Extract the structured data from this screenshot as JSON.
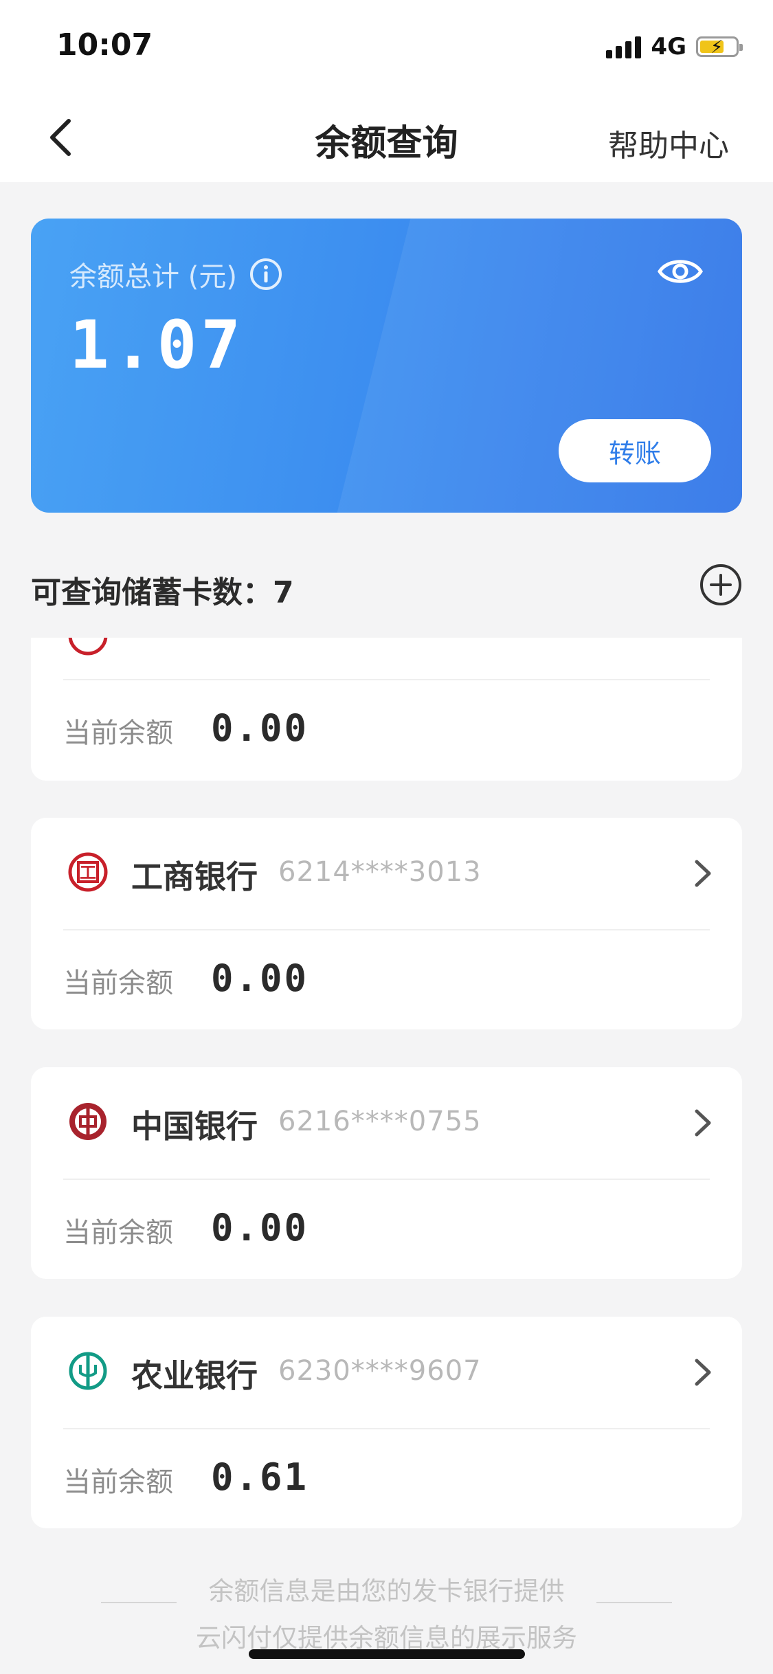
{
  "status_bar": {
    "time": "10:07",
    "network": "4G"
  },
  "nav": {
    "title": "余额查询",
    "help": "帮助中心"
  },
  "summary": {
    "label": "余额总计 (元)",
    "amount": "1.07",
    "transfer_button": "转账"
  },
  "cards_count_label": "可查询储蓄卡数：7",
  "balance_label": "当前余额",
  "cards": [
    {
      "bank": "",
      "number": "",
      "balance": "0.00",
      "logo": "bank-logo-red",
      "color": "#c8202a"
    },
    {
      "bank": "工商银行",
      "number": "6214****3013",
      "balance": "0.00",
      "logo": "icbc-logo",
      "color": "#c8202a"
    },
    {
      "bank": "中国银行",
      "number": "6216****0755",
      "balance": "0.00",
      "logo": "boc-logo",
      "color": "#a8232d"
    },
    {
      "bank": "农业银行",
      "number": "6230****9607",
      "balance": "0.61",
      "logo": "abc-logo",
      "color": "#129b86"
    }
  ],
  "footer": {
    "line1": "余额信息是由您的发卡银行提供",
    "line2": "云闪付仅提供余额信息的展示服务"
  },
  "colors": {
    "accent": "#3d8ff0",
    "background": "#f4f4f5"
  }
}
